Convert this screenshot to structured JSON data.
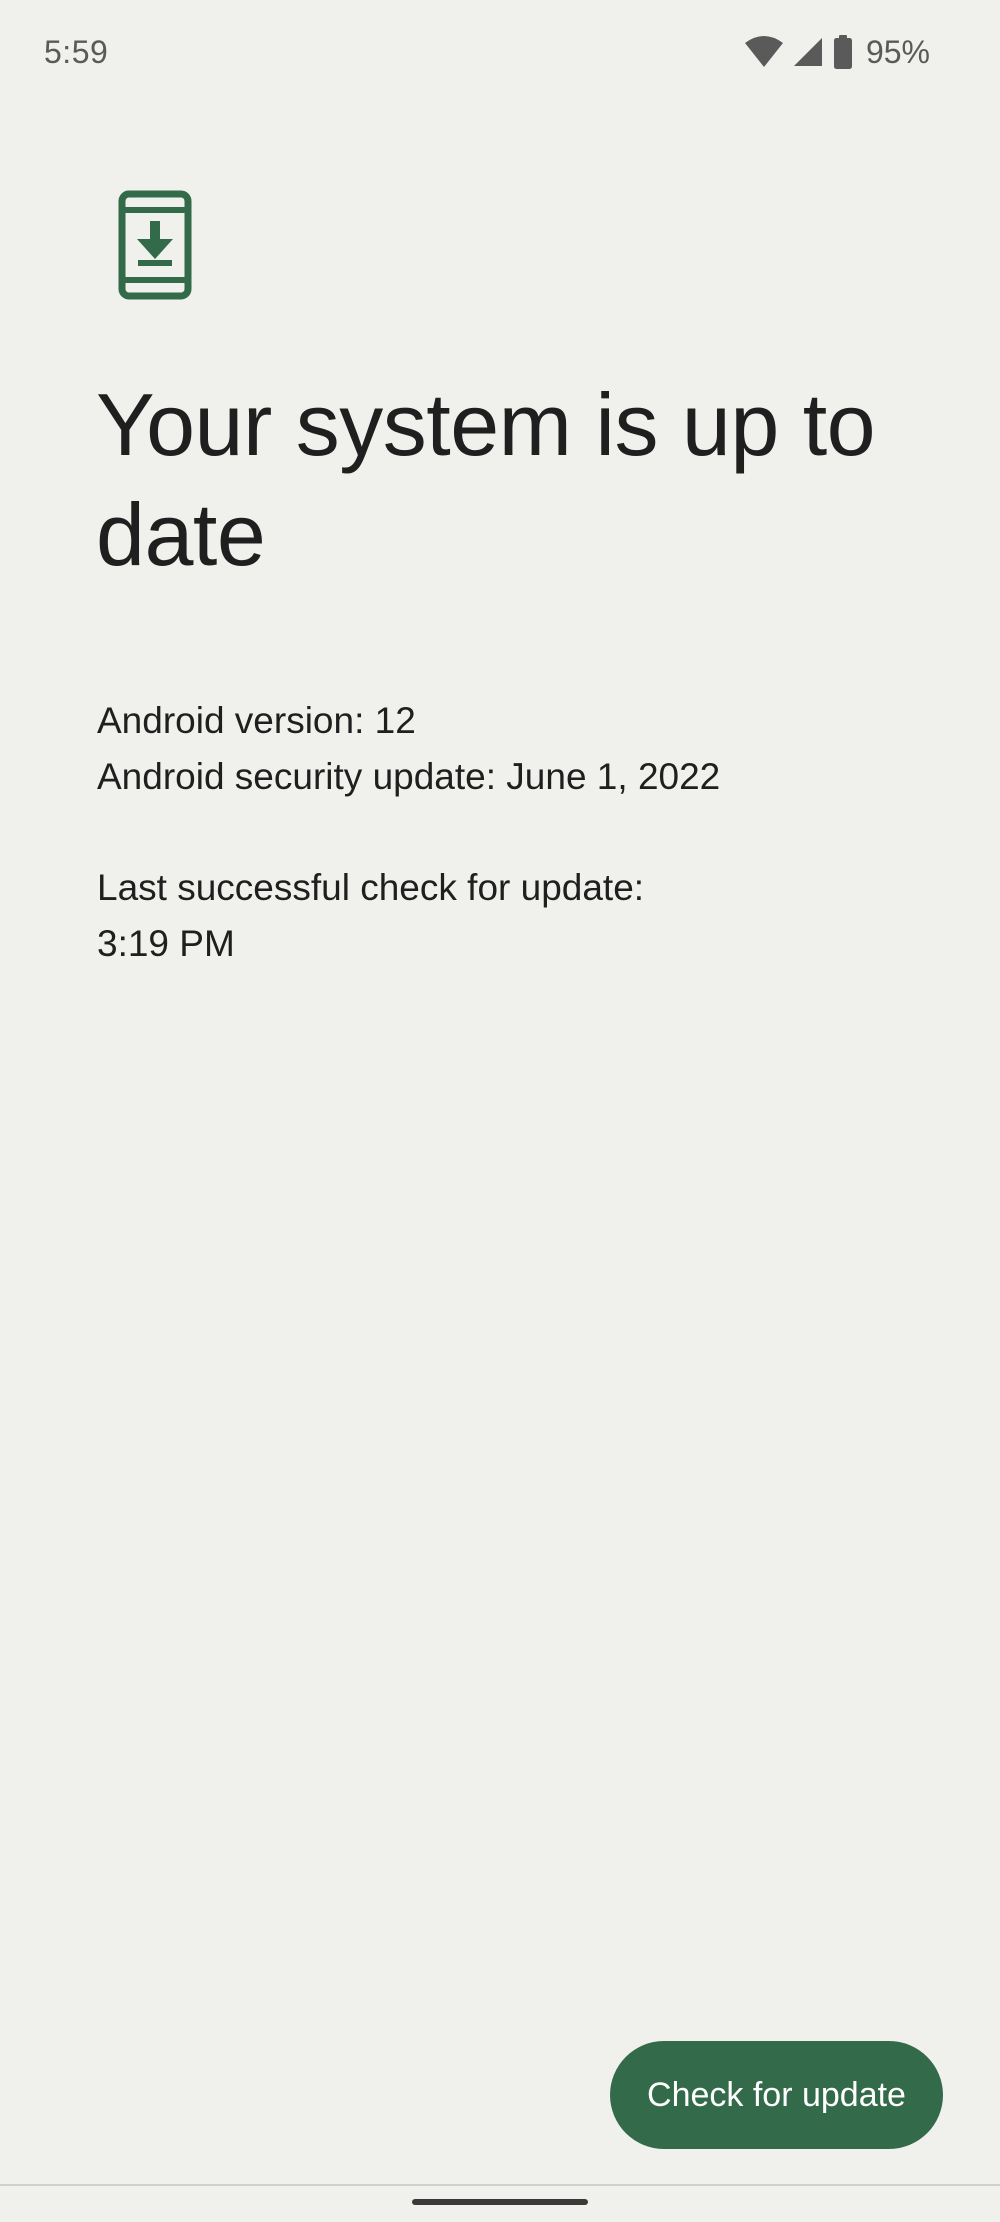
{
  "status_bar": {
    "time": "5:59",
    "battery_percent": "95%",
    "icons": [
      "wifi-icon",
      "cell-signal-icon",
      "battery-icon"
    ]
  },
  "header": {
    "icon": "system-update-icon",
    "title": "Your system is up to date"
  },
  "info": {
    "android_version": "Android version: 12",
    "security_update": "Android security update: June 1, 2022",
    "last_check_label": "Last successful check for update:",
    "last_check_time": "3:19 PM"
  },
  "actions": {
    "check_button_label": "Check for update"
  },
  "colors": {
    "accent": "#336b4a",
    "background": "#f0f0ec",
    "text": "#1f1f1f"
  }
}
